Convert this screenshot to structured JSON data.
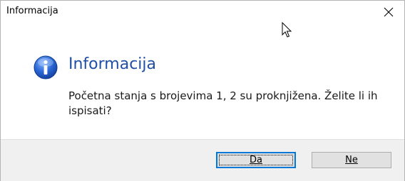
{
  "window": {
    "title": "Informacija",
    "close_glyph": "✕"
  },
  "dialog": {
    "icon": "info-icon",
    "heading": "Informacija",
    "message": "Početna stanja s brojevima 1, 2 su proknjižena. Želite li ih ispisati?"
  },
  "buttons": {
    "yes_label": "Da",
    "no_label": "Ne"
  },
  "colors": {
    "heading": "#1f4fa6",
    "footer_bg": "#f0f0f0",
    "default_button_border": "#0078d7"
  }
}
